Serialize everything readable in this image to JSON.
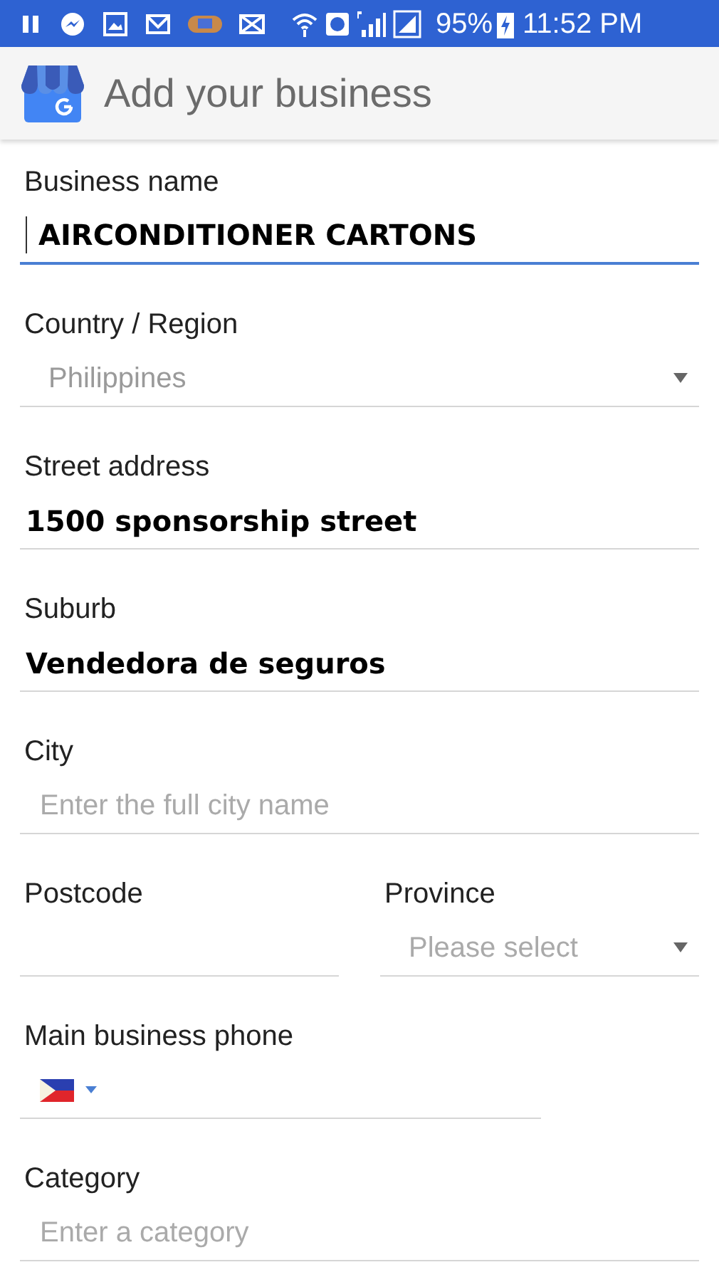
{
  "status_bar": {
    "battery": "95%",
    "time": "11:52 PM"
  },
  "app_bar": {
    "title": "Add your business"
  },
  "form": {
    "rows": [
      {
        "fields": [
          {
            "kind": "text",
            "label": "Business name",
            "value": "AIRCONDITIONER CARTONS",
            "focused": true
          }
        ]
      },
      {
        "fields": [
          {
            "kind": "select",
            "label": "Country / Region",
            "value": "Philippines",
            "focused": false
          }
        ]
      },
      {
        "fields": [
          {
            "kind": "text",
            "label": "Street address",
            "value": "1500 sponsorship street",
            "focused": false
          }
        ]
      },
      {
        "fields": [
          {
            "kind": "text",
            "label": "Suburb",
            "value": "Vendedora de seguros",
            "focused": false
          }
        ]
      },
      {
        "fields": [
          {
            "kind": "text",
            "label": "City",
            "placeholder": "Enter the full city name",
            "focused": false
          }
        ]
      },
      {
        "fields": [
          {
            "kind": "text",
            "label": "Postcode",
            "focused": false
          },
          {
            "kind": "select",
            "label": "Province",
            "placeholder": "Please select",
            "focused": false
          }
        ]
      },
      {
        "fields": [
          {
            "kind": "phone",
            "label": "Main business phone",
            "focused": false
          }
        ]
      },
      {
        "fields": [
          {
            "kind": "text",
            "label": "Category",
            "placeholder": "Enter a category",
            "focused": false
          }
        ]
      }
    ]
  }
}
